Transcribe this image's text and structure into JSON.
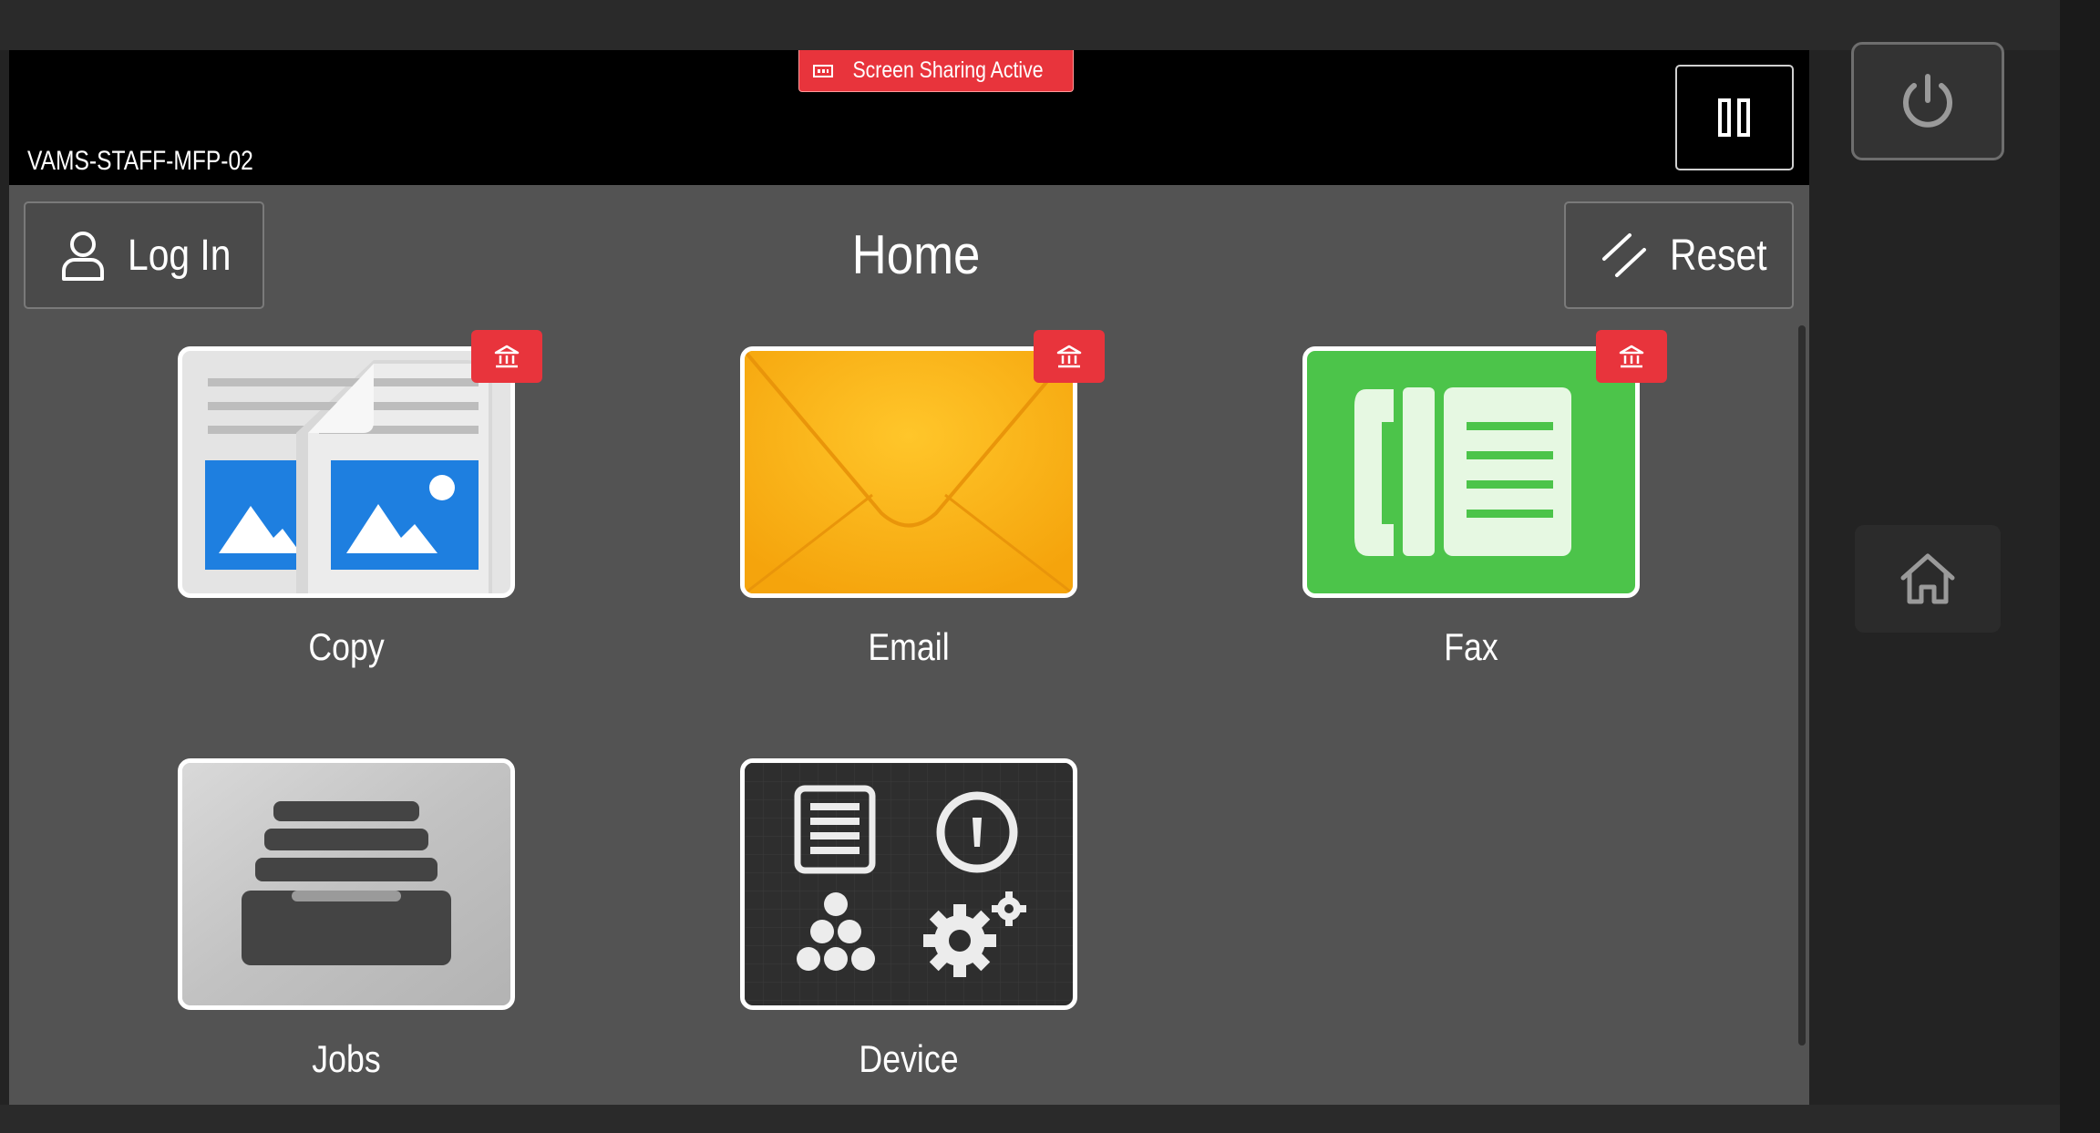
{
  "device": {
    "name": "VAMS-STAFF-MFP-02"
  },
  "status": {
    "screen_sharing": "Screen Sharing Active"
  },
  "header": {
    "login_label": "Log In",
    "title": "Home",
    "reset_label": "Reset"
  },
  "apps": [
    {
      "label": "Copy",
      "icon": "copy-icon"
    },
    {
      "label": "Email",
      "icon": "envelope-icon"
    },
    {
      "label": "Fax",
      "icon": "fax-icon"
    },
    {
      "label": "Jobs",
      "icon": "jobs-drawer-icon"
    },
    {
      "label": "Device",
      "icon": "device-settings-icon"
    }
  ],
  "colors": {
    "badge_red": "#e8343c",
    "email_yellow": "#fbb414",
    "fax_green": "#4cc44a",
    "copy_blue": "#1e7fe0",
    "screen_gray": "#535353"
  }
}
